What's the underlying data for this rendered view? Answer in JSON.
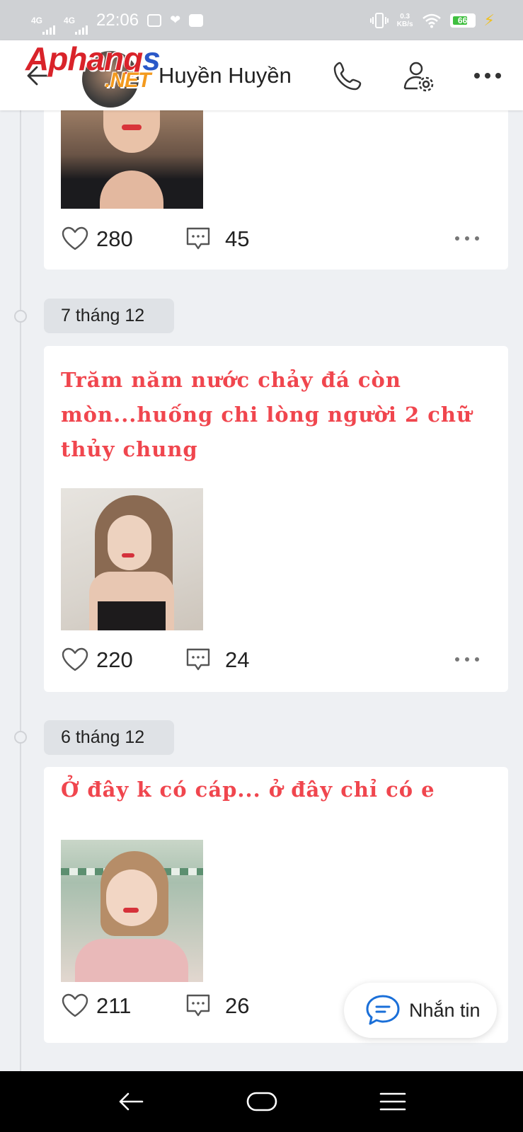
{
  "status_bar": {
    "network1": "4G",
    "network2": "4G",
    "time": "22:06",
    "speed_value": "0.3",
    "speed_unit": "KB/s",
    "battery": "66",
    "icons": [
      "signal-icon",
      "signal-icon",
      "screen-record-icon",
      "heart-app-icon",
      "message-app-icon",
      "vibrate-icon",
      "wifi-icon",
      "battery-icon",
      "charging-icon"
    ]
  },
  "header": {
    "logo_part1": "Aphang",
    "logo_part2": "s",
    "logo_sub": ".NET",
    "contact_name": "Huyền Huyền",
    "icons": [
      "back-arrow-icon",
      "phone-icon",
      "profile-settings-icon",
      "more-icon"
    ]
  },
  "posts": [
    {
      "date": "",
      "caption": "",
      "likes": "280",
      "comments": "45"
    },
    {
      "date": "7 tháng 12",
      "caption": "Trăm năm nước chảy đá còn mòn...huống chi lòng người  2 chữ thủy chung",
      "likes": "220",
      "comments": "24"
    },
    {
      "date": "6 tháng 12",
      "caption": "Ở đây k có cáp... ở đây chỉ có e",
      "likes": "211",
      "comments": "26"
    }
  ],
  "fab": {
    "label": "Nhắn tin",
    "icon": "chat-bubble-icon"
  },
  "colors": {
    "caption": "#f0464e",
    "background": "#eef0f3",
    "fab_icon": "#1a6fd8"
  },
  "nav_bar": {
    "icons": [
      "nav-back-icon",
      "nav-home-icon",
      "nav-menu-icon"
    ]
  }
}
